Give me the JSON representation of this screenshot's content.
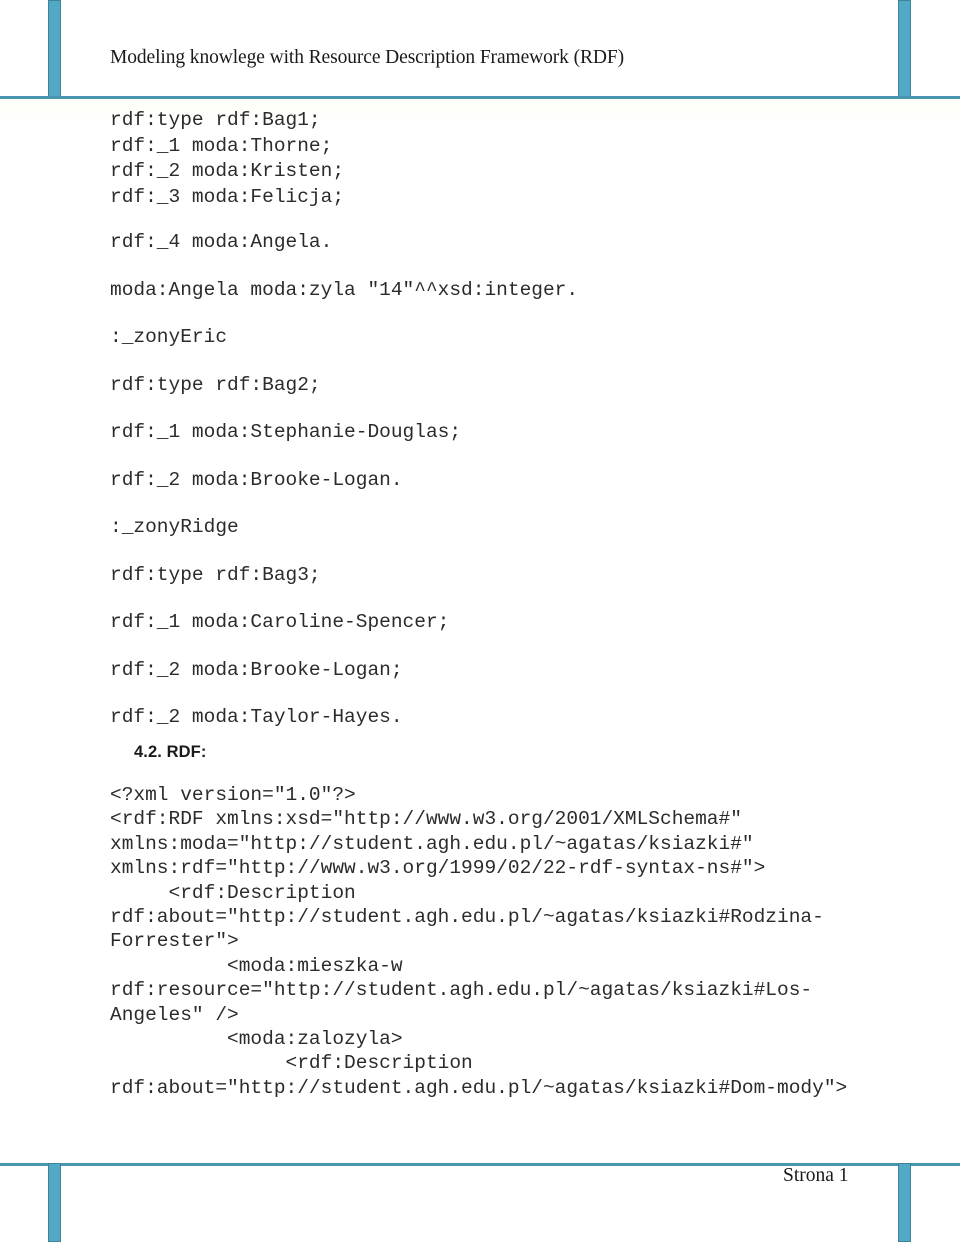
{
  "header": {
    "title": "Modeling knowlege with Resource Description Framework (RDF)",
    "accent_color": "#51A9C6",
    "rule_color": "#4795AE"
  },
  "body": {
    "turtle_tight_lines": [
      "rdf:type rdf:Bag1;",
      "rdf:_1 moda:Thorne;",
      "rdf:_2 moda:Kristen;",
      "rdf:_3 moda:Felicja;"
    ],
    "turtle_loose_lines": [
      "rdf:_4 moda:Angela.",
      "moda:Angela moda:zyla \"14\"^^xsd:integer.",
      ":_zonyEric",
      "rdf:type rdf:Bag2;",
      "rdf:_1 moda:Stephanie-Douglas;",
      "rdf:_2 moda:Brooke-Logan.",
      ":_zonyRidge",
      "rdf:type rdf:Bag3;",
      "rdf:_1 moda:Caroline-Spencer;",
      "rdf:_2 moda:Brooke-Logan;",
      "rdf:_2 moda:Taylor-Hayes."
    ],
    "section_heading": "4.2. RDF:",
    "xml_lines": [
      "<?xml version=\"1.0\"?>",
      "<rdf:RDF xmlns:xsd=\"http://www.w3.org/2001/XMLSchema#\"",
      "xmlns:moda=\"http://student.agh.edu.pl/~agatas/ksiazki#\"",
      "xmlns:rdf=\"http://www.w3.org/1999/02/22-rdf-syntax-ns#\">",
      "     <rdf:Description",
      "rdf:about=\"http://student.agh.edu.pl/~agatas/ksiazki#Rodzina-",
      "Forrester\">",
      "          <moda:mieszka-w",
      "rdf:resource=\"http://student.agh.edu.pl/~agatas/ksiazki#Los-",
      "Angeles\" />",
      "          <moda:zalozyla>",
      "               <rdf:Description",
      "rdf:about=\"http://student.agh.edu.pl/~agatas/ksiazki#Dom-mody\">"
    ]
  },
  "footer": {
    "page_label": "Strona 1"
  }
}
